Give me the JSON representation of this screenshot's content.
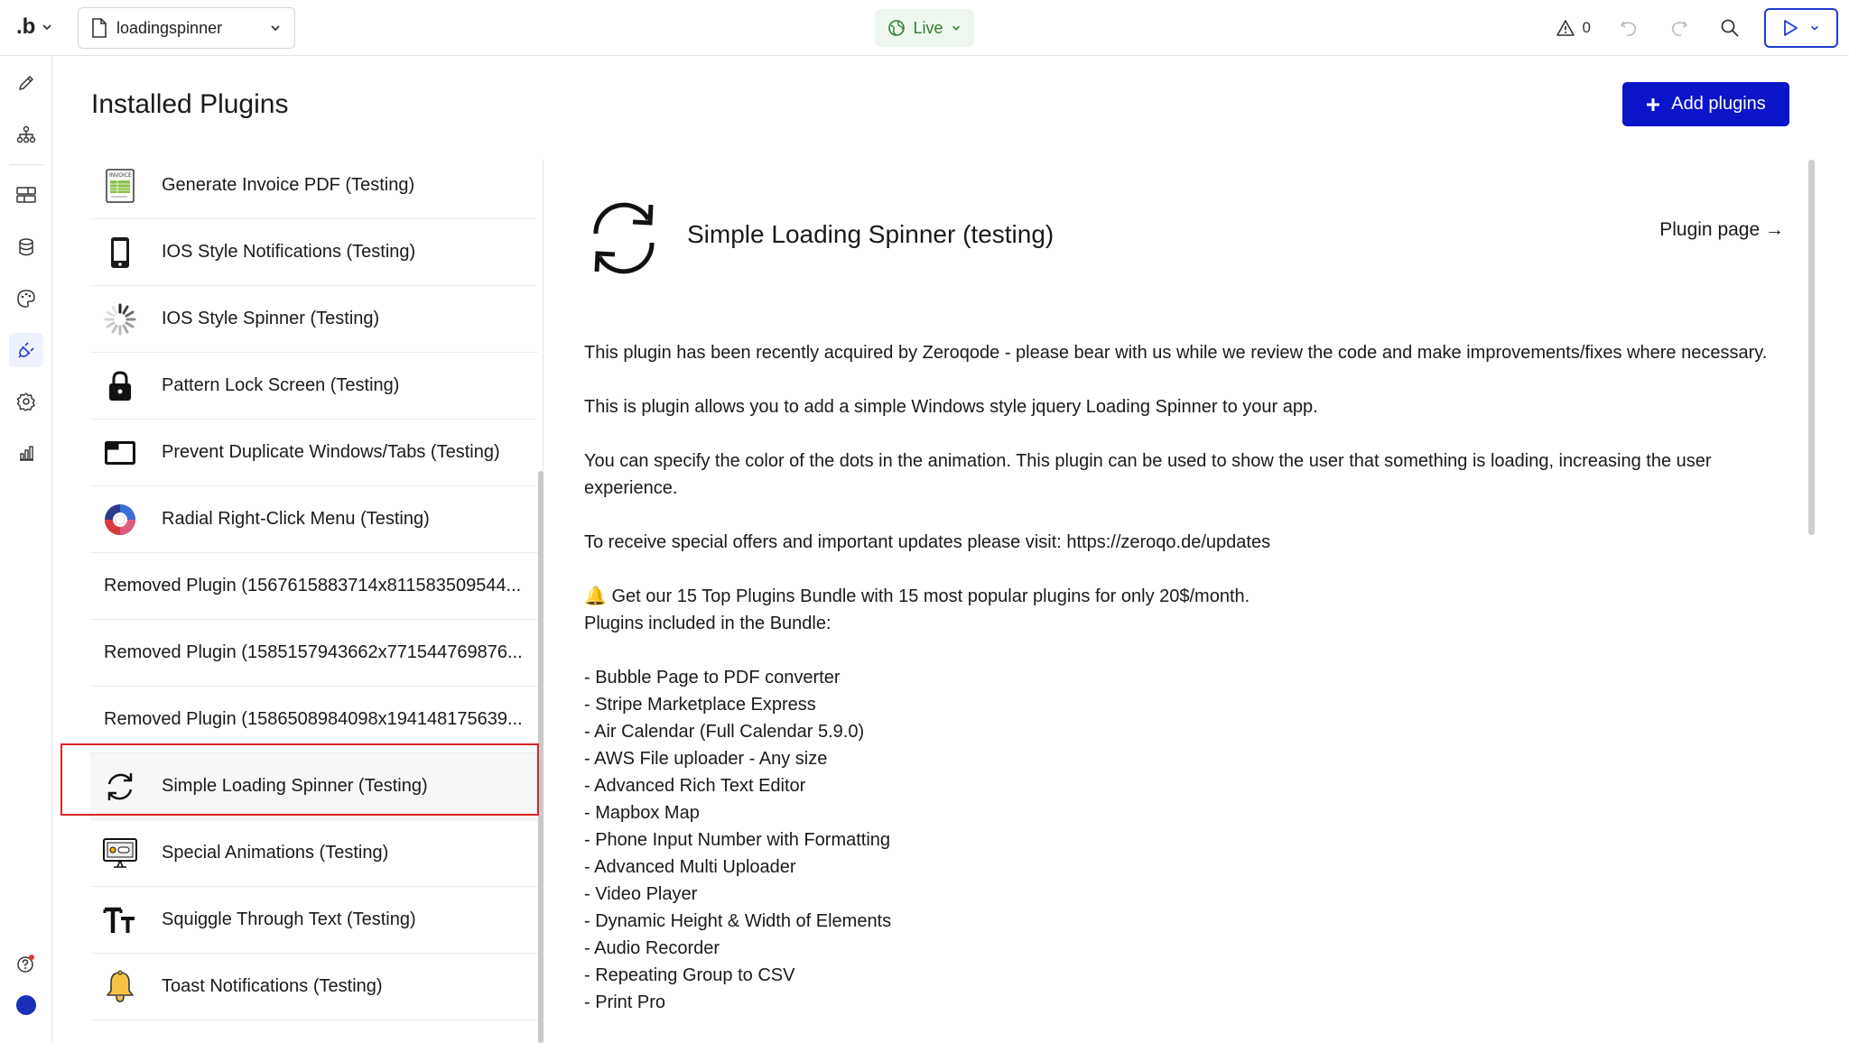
{
  "topbar": {
    "logo": ".b",
    "page_name": "loadingspinner",
    "live_label": "Live",
    "issue_count": "0"
  },
  "main": {
    "title": "Installed Plugins",
    "add_button_label": "Add plugins"
  },
  "plugins": [
    {
      "label": "Generate Invoice PDF (Testing)",
      "icon": "invoice-icon"
    },
    {
      "label": "IOS Style Notifications (Testing)",
      "icon": "phone-icon"
    },
    {
      "label": "IOS Style Spinner (Testing)",
      "icon": "spinner-icon"
    },
    {
      "label": "Pattern Lock Screen (Testing)",
      "icon": "lock-icon"
    },
    {
      "label": "Prevent Duplicate Windows/Tabs (Testing)",
      "icon": "window-icon"
    },
    {
      "label": "Radial Right-Click Menu (Testing)",
      "icon": "radial-menu-icon"
    },
    {
      "label": "Removed Plugin (1567615883714x811583509544...",
      "icon": ""
    },
    {
      "label": "Removed Plugin (1585157943662x771544769876...",
      "icon": ""
    },
    {
      "label": "Removed Plugin (1586508984098x194148175639...",
      "icon": ""
    },
    {
      "label": "Simple Loading Spinner (Testing)",
      "icon": "refresh-icon",
      "selected": true
    },
    {
      "label": "Special Animations (Testing)",
      "icon": "animation-icon"
    },
    {
      "label": "Squiggle Through Text (Testing)",
      "icon": "text-size-icon"
    },
    {
      "label": "Toast Notifications (Testing)",
      "icon": "bell-icon"
    }
  ],
  "detail": {
    "title": "Simple Loading Spinner (testing)",
    "plugin_page_link": "Plugin page →",
    "paragraphs": [
      "This plugin has been recently acquired by Zeroqode - please bear with us while we review the code and make improvements/fixes where necessary.",
      "This is plugin allows you to add a simple Windows style jquery Loading Spinner to your app.",
      "You can specify the color of the dots in the animation. This plugin can be used to show the user that something is loading, increasing the user experience.",
      "To receive special offers and important updates please visit: https://zeroqo.de/updates"
    ],
    "bundle_intro": "🔔 Get our 15 Top Plugins Bundle with 15 most popular plugins for only 20$/month.",
    "bundle_heading": "Plugins included in the Bundle:",
    "bundle_items": [
      "- Bubble Page to PDF converter",
      "- Stripe Marketplace Express",
      "- Air Calendar (Full Calendar 5.9.0)",
      "- AWS File uploader - Any size",
      "- Advanced Rich Text Editor",
      "- Mapbox Map",
      "- Phone Input Number with Formatting",
      "- Advanced Multi Uploader",
      "- Video Player",
      "- Dynamic Height & Width of Elements",
      "- Audio Recorder",
      "- Repeating Group to CSV",
      "- Print Pro"
    ]
  },
  "colors": {
    "accent": "#0a14c9",
    "live_green": "#2e7d32",
    "selection_outline": "#e02424"
  }
}
